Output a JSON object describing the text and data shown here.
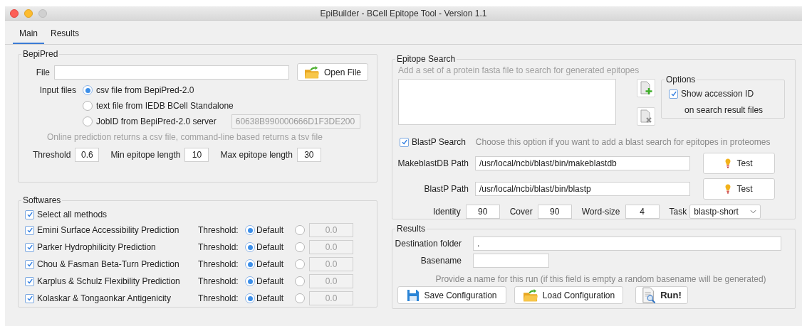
{
  "window": {
    "title": "EpiBuilder - BCell Epitope Tool - Version 1.1"
  },
  "tabs": [
    {
      "label": "Main",
      "selected": true
    },
    {
      "label": "Results",
      "selected": false
    }
  ],
  "bepipred": {
    "title": "BepiPred",
    "file": {
      "label": "File"
    },
    "open_button": "Open File",
    "input_label": "Input files",
    "options": [
      {
        "label": "csv file from BepiPred-2.0",
        "selected": true
      },
      {
        "label": "text file from IEDB BCell Standalone",
        "selected": false
      },
      {
        "label": "JobID from BepiPred-2.0 server",
        "selected": false
      }
    ],
    "job_id": {
      "value": "60638B990000666D1F3DE200",
      "disabled": true
    },
    "note": "Online prediction returns a csv file, command-line based returns a tsv file",
    "params": [
      {
        "label": "Threshold",
        "value": "0.6"
      },
      {
        "label": "Min epitope length",
        "value": "10"
      },
      {
        "label": "Max epitope length",
        "value": "30"
      }
    ]
  },
  "softwares": {
    "title": "Softwares",
    "select_all": {
      "label": "Select all methods",
      "checked": true
    },
    "methods": [
      {
        "name": "Emini Surface Accessibility Prediction",
        "checked": true,
        "threshold_label": "Threshold:",
        "default": {
          "label": "Default",
          "selected": true
        },
        "custom": {
          "selected": false,
          "value": "0.0"
        }
      },
      {
        "name": "Parker Hydrophilicity Prediction",
        "checked": true,
        "threshold_label": "Threshold:",
        "default": {
          "label": "Default",
          "selected": true
        },
        "custom": {
          "selected": false,
          "value": "0.0"
        }
      },
      {
        "name": "Chou & Fasman Beta-Turn Prediction",
        "checked": true,
        "threshold_label": "Threshold:",
        "default": {
          "label": "Default",
          "selected": true
        },
        "custom": {
          "selected": false,
          "value": "0.0"
        }
      },
      {
        "name": "Karplus & Schulz Flexibility Prediction",
        "checked": true,
        "threshold_label": "Threshold:",
        "default": {
          "label": "Default",
          "selected": true
        },
        "custom": {
          "selected": false,
          "value": "0.0"
        }
      },
      {
        "name": "Kolaskar & Tongaonkar Antigenicity",
        "checked": true,
        "threshold_label": "Threshold:",
        "default": {
          "label": "Default",
          "selected": true
        },
        "custom": {
          "selected": false,
          "value": "0.0"
        }
      }
    ]
  },
  "epitope_search": {
    "title": "Epitope Search",
    "hint": "Add a set of a protein fasta file to search for generated epitopes",
    "options": {
      "title": "Options",
      "checkbox": {
        "label": "Show accession ID",
        "checked": true
      },
      "detail": "on search result files"
    },
    "blastp": {
      "label": "BlastP Search",
      "checked": true,
      "hint": "Choose this option if you want to add a blast search for epitopes in proteomes"
    },
    "paths": [
      {
        "label": "MakeblastDB Path",
        "value": "/usr/local/ncbi/blast/bin/makeblastdb",
        "button": "Test"
      },
      {
        "label": "BlastP Path",
        "value": "/usr/local/ncbi/blast/bin/blastp",
        "button": "Test"
      }
    ],
    "params": [
      {
        "label": "Identity",
        "value": "90"
      },
      {
        "label": "Cover",
        "value": "90"
      },
      {
        "label": "Word-size",
        "value": "4"
      }
    ],
    "task": {
      "label": "Task",
      "value": "blastp-short"
    }
  },
  "results": {
    "title": "Results",
    "destination": {
      "label": "Destination folder",
      "value": "."
    },
    "basename": {
      "label": "Basename"
    },
    "note": "Provide a name for this run (if this field is empty a random basename will be generated)",
    "buttons": [
      {
        "label": "Save Configuration",
        "kind": "save"
      },
      {
        "label": "Load Configuration",
        "kind": "load"
      },
      {
        "label": "Run!",
        "kind": "run"
      }
    ]
  }
}
